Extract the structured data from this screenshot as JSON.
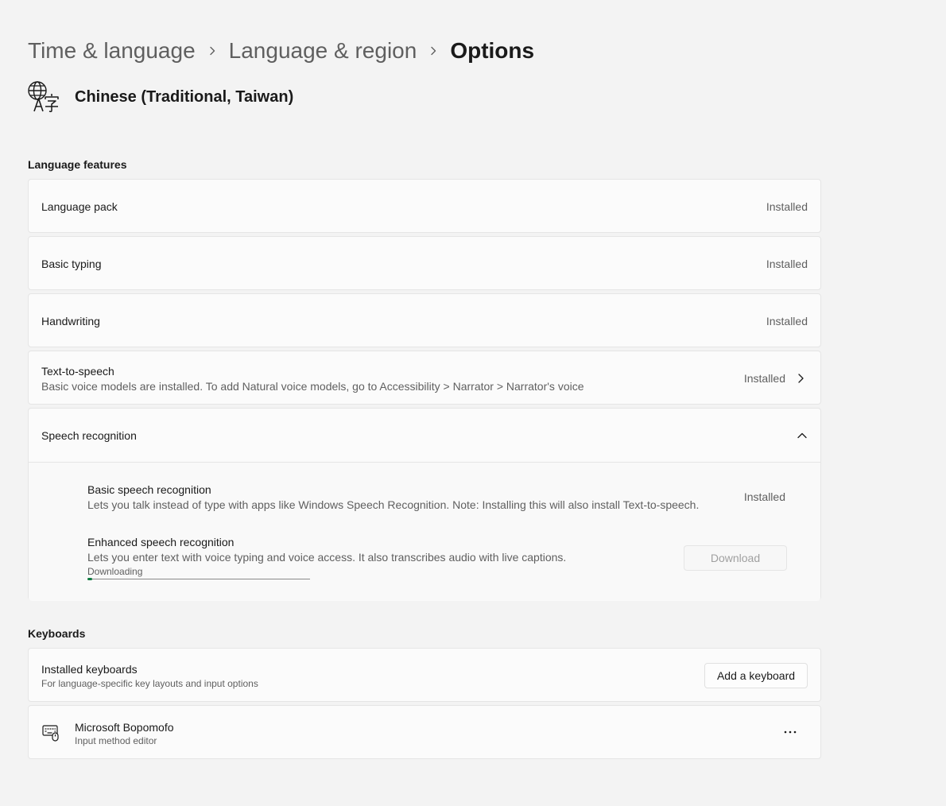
{
  "breadcrumb": [
    "Time & language",
    "Language & region",
    "Options"
  ],
  "language": {
    "title": "Chinese (Traditional, Taiwan)",
    "icon": "language-translate-icon"
  },
  "features": {
    "section_label": "Language features",
    "language_pack": {
      "title": "Language pack",
      "status": "Installed"
    },
    "basic_typing": {
      "title": "Basic typing",
      "status": "Installed"
    },
    "handwriting": {
      "title": "Handwriting",
      "status": "Installed"
    },
    "tts": {
      "title": "Text-to-speech",
      "description": "Basic voice models are installed. To add Natural voice models, go to Accessibility > Narrator > Narrator's voice",
      "status": "Installed"
    },
    "speech": {
      "title": "Speech recognition",
      "basic": {
        "title": "Basic speech recognition",
        "description": "Lets you talk instead of type with apps like Windows Speech Recognition. Note: Installing this will also install Text-to-speech.",
        "status": "Installed"
      },
      "enhanced": {
        "title": "Enhanced speech recognition",
        "description": "Lets you enter text with voice typing and voice access. It also transcribes audio with live captions.",
        "progress_label": "Downloading",
        "progress": 0.02,
        "button": "Download"
      }
    }
  },
  "keyboards": {
    "section_label": "Keyboards",
    "installed": {
      "title": "Installed keyboards",
      "description": "For language-specific key layouts and input options",
      "button": "Add a keyboard"
    },
    "items": [
      {
        "title": "Microsoft Bopomofo",
        "subtitle": "Input method editor",
        "icon": "keyboard-icon"
      }
    ]
  },
  "colors": {
    "accent": "#107c41",
    "background": "#f3f3f3",
    "card": "#fbfbfb"
  }
}
